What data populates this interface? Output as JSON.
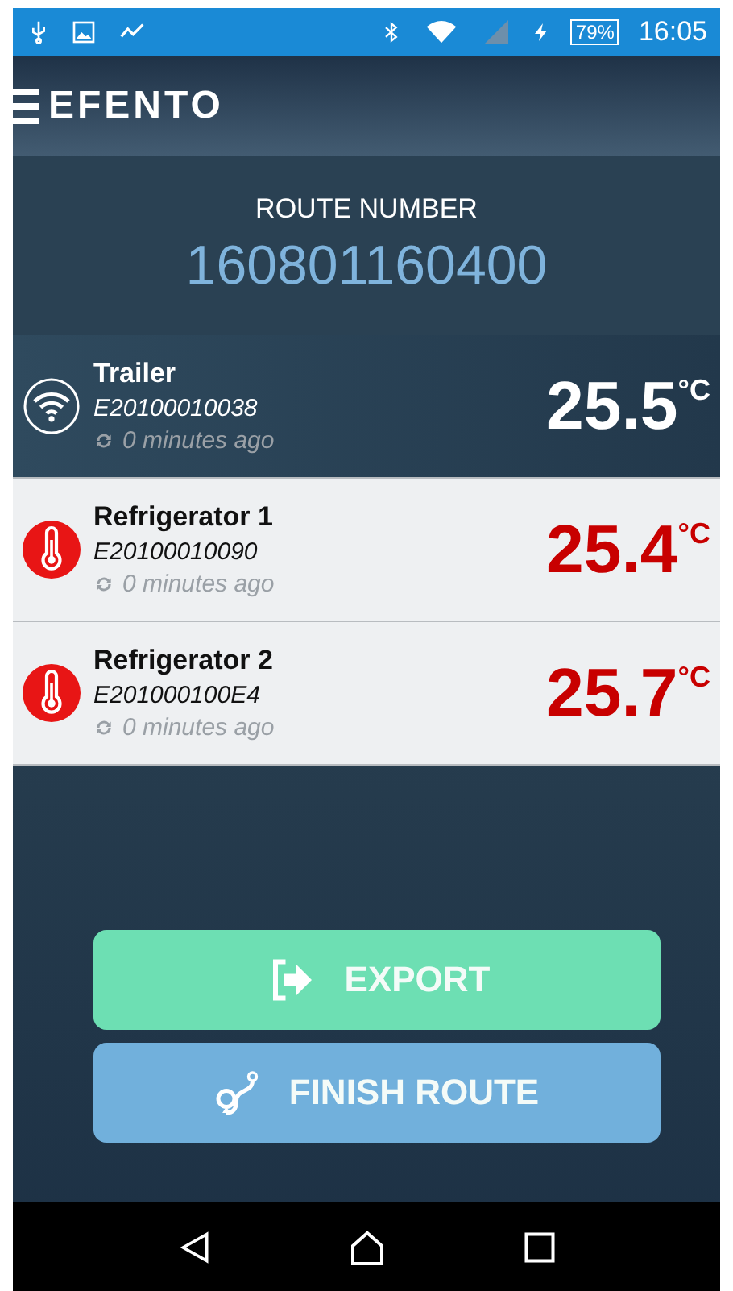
{
  "status_bar": {
    "battery": "79%",
    "time": "16:05"
  },
  "app_bar": {
    "logo": "EFENTO"
  },
  "route": {
    "label": "ROUTE NUMBER",
    "number": "160801160400"
  },
  "sensors": [
    {
      "name": "Trailer",
      "id": "E20100010038",
      "updated": "0 minutes ago",
      "temperature": "25.5",
      "unit": "°C",
      "kind": "wireless",
      "alarm": false
    },
    {
      "name": "Refrigerator 1",
      "id": "E20100010090",
      "updated": "0 minutes ago",
      "temperature": "25.4",
      "unit": "°C",
      "kind": "thermometer",
      "alarm": true
    },
    {
      "name": "Refrigerator 2",
      "id": "E201000100E4",
      "updated": "0 minutes ago",
      "temperature": "25.7",
      "unit": "°C",
      "kind": "thermometer",
      "alarm": true
    }
  ],
  "buttons": [
    {
      "label": "EXPORT",
      "kind": "export"
    },
    {
      "label": "FINISH ROUTE",
      "kind": "finish"
    }
  ]
}
